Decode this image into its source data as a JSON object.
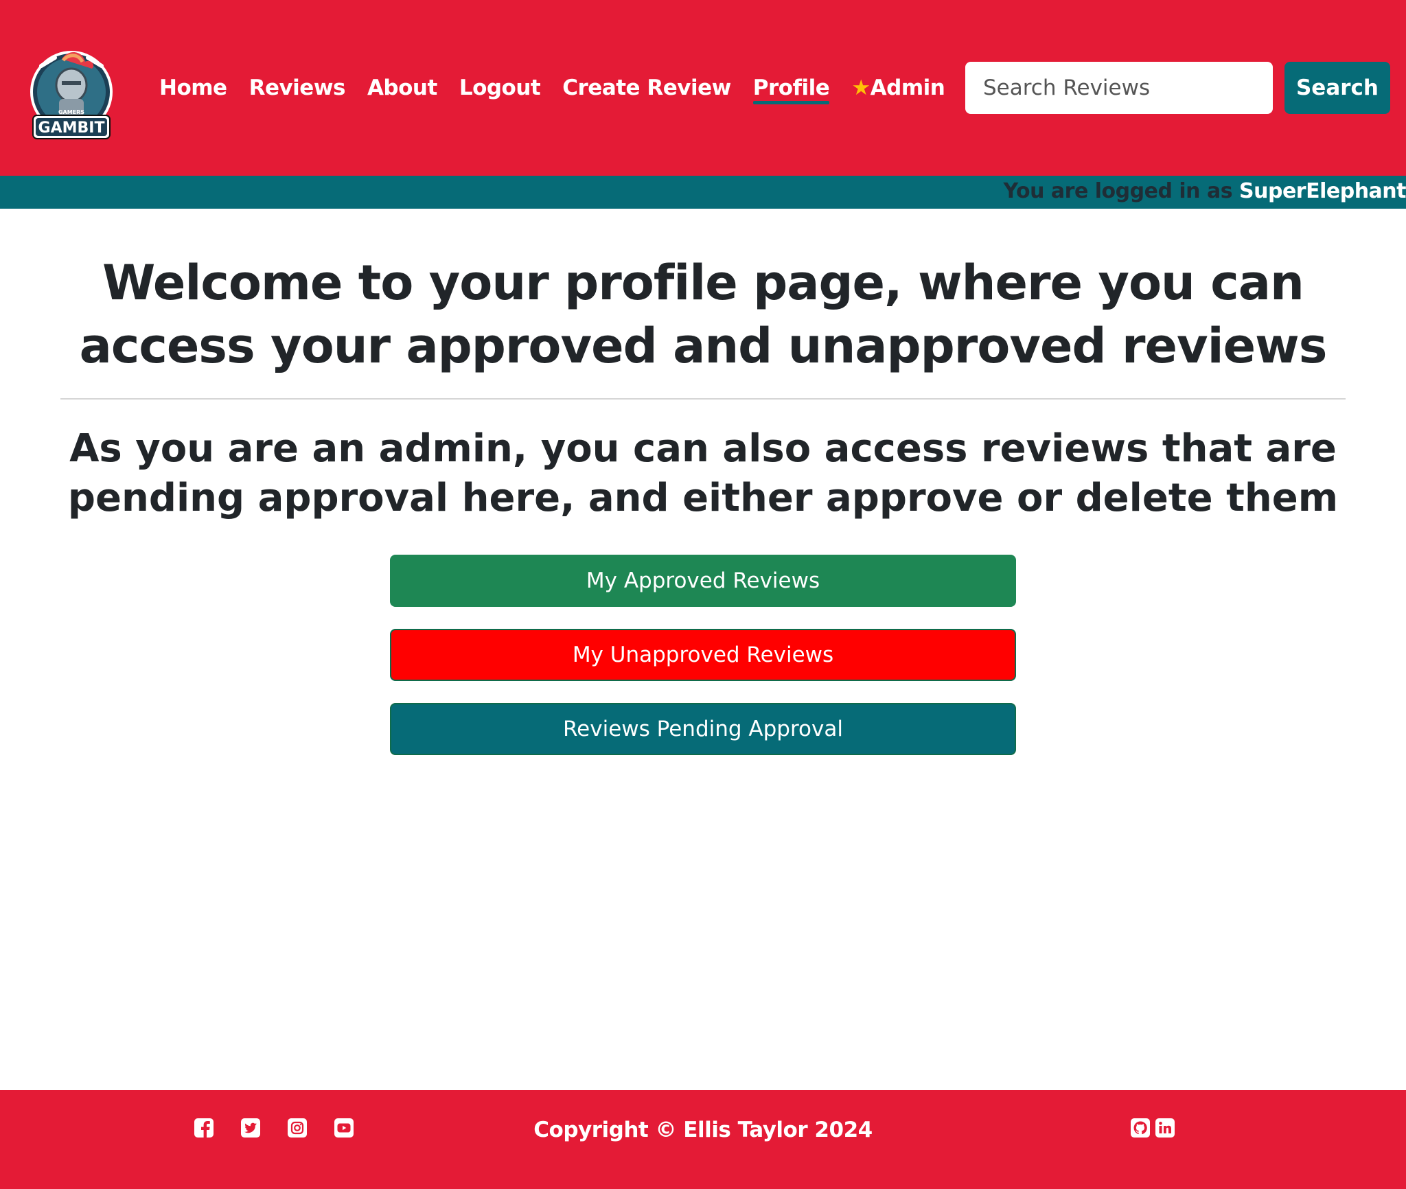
{
  "header": {
    "logo_text_small": "GAMERS",
    "logo_text": "GAMBIT",
    "nav": [
      {
        "label": "Home"
      },
      {
        "label": "Reviews"
      },
      {
        "label": "About"
      },
      {
        "label": "Logout"
      },
      {
        "label": "Create Review"
      },
      {
        "label": "Profile",
        "active": true
      },
      {
        "label": "Admin",
        "icon": "star-icon"
      }
    ],
    "search_placeholder": "Search Reviews",
    "search_button": "Search"
  },
  "login_status": {
    "prefix": "You are logged in as",
    "username": "SuperElephant"
  },
  "main": {
    "title": "Welcome to your profile page, where you can access your approved and unapproved reviews",
    "subtitle": "As you are an admin, you can also access reviews that are pending approval here, and either approve or delete them",
    "buttons": {
      "approved": "My Approved Reviews",
      "unapproved": "My Unapproved Reviews",
      "pending": "Reviews Pending Approval"
    }
  },
  "footer": {
    "social_icons": [
      "facebook-icon",
      "twitter-icon",
      "instagram-icon",
      "youtube-icon"
    ],
    "copyright": "Copyright © Ellis Taylor 2024",
    "right_icons": [
      "github-icon",
      "linkedin-icon"
    ]
  },
  "colors": {
    "brand_red": "#e41b36",
    "brand_teal": "#066b77",
    "success_green": "#1e8754",
    "danger_red": "#ff0000"
  }
}
